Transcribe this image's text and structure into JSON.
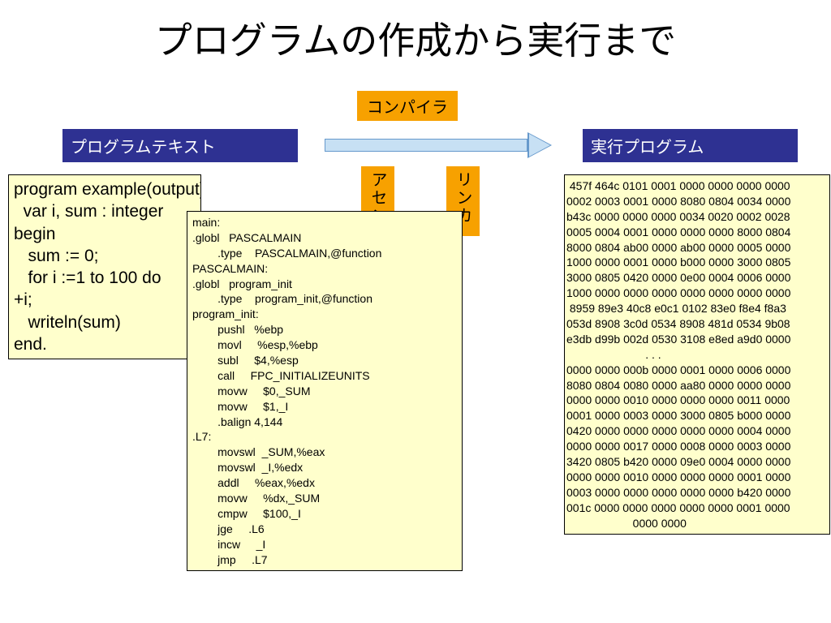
{
  "title": "プログラムの作成から実行まで",
  "labels": {
    "program_text": "プログラムテキスト",
    "compiler": "コンパイラ",
    "executable": "実行プログラム",
    "assembler": "アセン",
    "linker": "リンカ"
  },
  "source_code": "program example(output);\n  var i, sum : integer\nbegin\n   sum := 0;\n   for i :=1 to 100 do\n+i;\n   writeln(sum)\nend.",
  "assembly_code": "main:\n.globl   PASCALMAIN\n        .type    PASCALMAIN,@function\nPASCALMAIN:\n.globl   program_init\n        .type    program_init,@function\nprogram_init:\n        pushl   %ebp\n        movl     %esp,%ebp\n        subl     $4,%esp\n        call     FPC_INITIALIZEUNITS\n        movw     $0,_SUM\n        movw     $1,_I\n        .balign 4,144\n.L7:\n        movswl  _SUM,%eax\n        movswl  _I,%edx\n        addl     %eax,%edx\n        movw     %dx,_SUM\n        cmpw     $100,_I\n        jge     .L6\n        incw     _I\n        jmp     .L7",
  "hex_dump": " 457f 464c 0101 0001 0000 0000 0000 0000\n0002 0003 0001 0000 8080 0804 0034 0000\nb43c 0000 0000 0000 0034 0020 0002 0028\n0005 0004 0001 0000 0000 0000 8000 0804\n8000 0804 ab00 0000 ab00 0000 0005 0000\n1000 0000 0001 0000 b000 0000 3000 0805\n3000 0805 0420 0000 0e00 0004 0006 0000\n1000 0000 0000 0000 0000 0000 0000 0000\n 8959 89e3 40c8 e0c1 0102 83e0 f8e4 f8a3\n053d 8908 3c0d 0534 8908 481d 0534 9b08\ne3db d99b 002d 0530 3108 e8ed a9d0 0000\n                         . . .\n0000 0000 000b 0000 0001 0000 0006 0000\n8080 0804 0080 0000 aa80 0000 0000 0000\n0000 0000 0010 0000 0000 0000 0011 0000\n0001 0000 0003 0000 3000 0805 b000 0000\n0420 0000 0000 0000 0000 0000 0004 0000\n0000 0000 0017 0000 0008 0000 0003 0000\n3420 0805 b420 0000 09e0 0004 0000 0000\n0000 0000 0010 0000 0000 0000 0001 0000\n0003 0000 0000 0000 0000 0000 b420 0000\n001c 0000 0000 0000 0000 0000 0001 0000\n                     0000 0000"
}
